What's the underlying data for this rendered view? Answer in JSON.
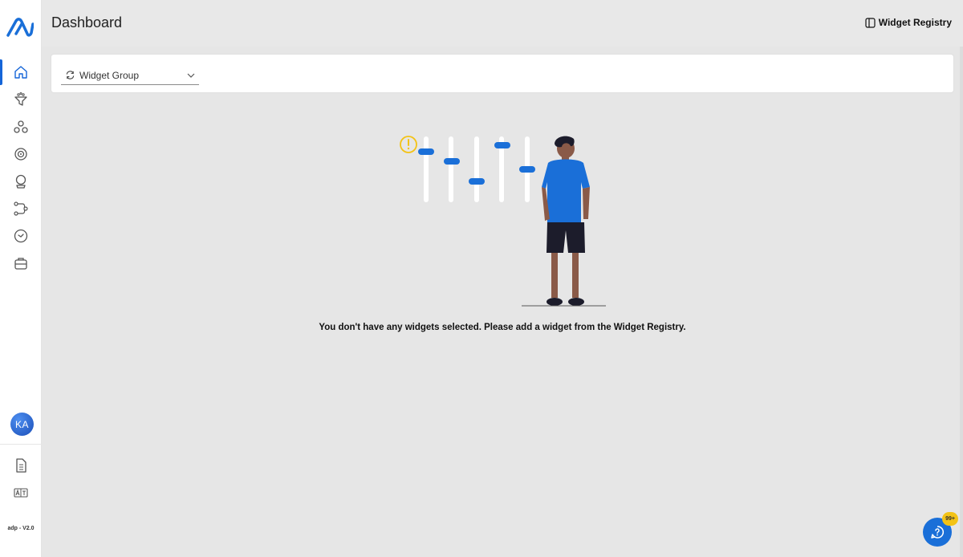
{
  "header": {
    "title": "Dashboard",
    "registry_label": "Widget Registry"
  },
  "sidebar": {
    "items": [
      {
        "icon": "home-icon",
        "active": true
      },
      {
        "icon": "funnel-icon"
      },
      {
        "icon": "nodes-icon"
      },
      {
        "icon": "target-icon"
      },
      {
        "icon": "crystal-ball-icon"
      },
      {
        "icon": "workflow-icon"
      },
      {
        "icon": "clock-icon"
      },
      {
        "icon": "briefcase-icon"
      }
    ],
    "avatar_initials": "KA",
    "bottom_items": [
      {
        "icon": "document-icon"
      },
      {
        "icon": "translate-icon"
      }
    ],
    "version": "adp - V2.0"
  },
  "widget_group": {
    "label": "Widget Group"
  },
  "empty_state": {
    "message": "You don't have any widgets selected. Please add a widget from the Widget Registry."
  },
  "help": {
    "badge": "99+"
  },
  "colors": {
    "accent": "#1565d8",
    "warning": "#f3c316",
    "background": "#e6e6e6"
  }
}
